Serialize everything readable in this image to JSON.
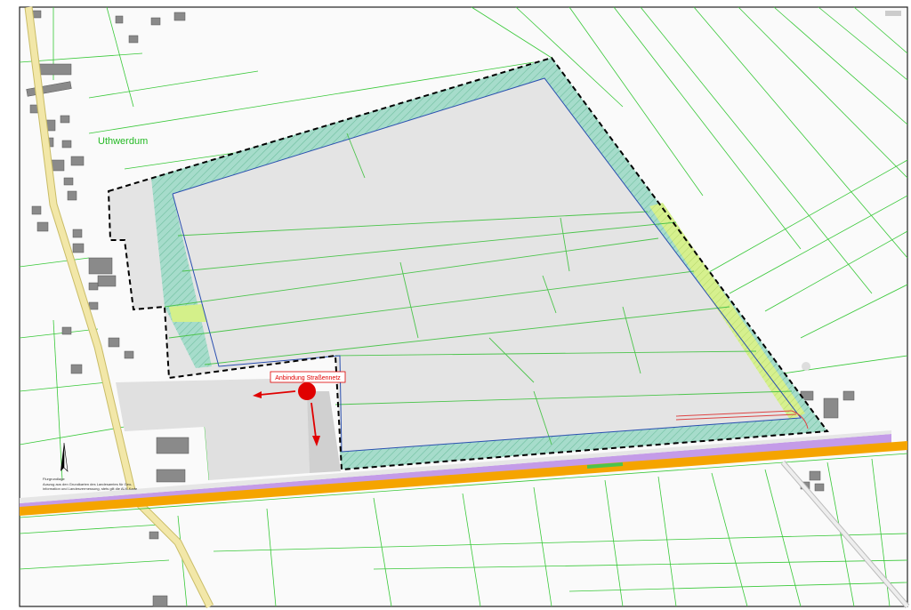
{
  "map": {
    "place_name": "Uthwerdum",
    "annotation_label": "Anbindung Straßennetz",
    "legend": {
      "title": "Flurgrundlage",
      "line1": "Auszug aus den Grundkarten des Landesamtes für Geo-",
      "line2": "information und Landesvermessung, stets gilt die ALK-Karte"
    },
    "colors": {
      "background": "#fafafa",
      "parcel_lines": "#38c838",
      "site_fill": "#e4e4e4",
      "buffer_strip": "#9fd8c4",
      "green_strip": "#d4f08a",
      "boundary_dashed": "#000000",
      "inner_boundary": "#2a4fb0",
      "railway": "#c49be8",
      "road_orange": "#f5a400",
      "road_yellow": "#f2e7a8",
      "marker": "#e00000",
      "building": "#9a9a9a"
    }
  }
}
